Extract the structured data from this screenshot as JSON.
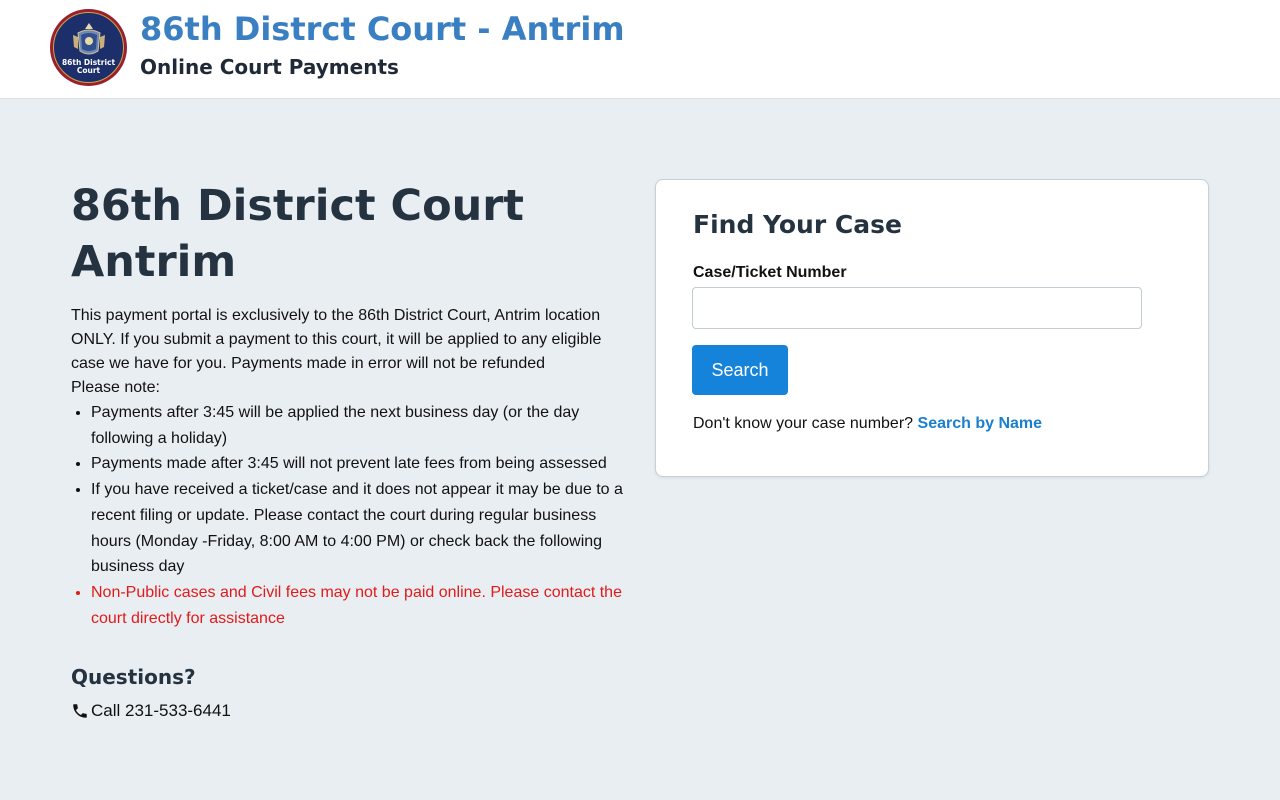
{
  "header": {
    "logo_text_line1": "86th District",
    "logo_text_line2": "Court",
    "title": "86th Distrct Court - Antrim",
    "subtitle": "Online Court Payments"
  },
  "main": {
    "title_line1": "86th District Court",
    "title_line2": "Antrim",
    "intro": "This payment portal is exclusively to the 86th District Court, Antrim location ONLY. If you submit a payment to this court, it will be applied to any eligible case we have for you. Payments made in error will not be refunded",
    "note_label": "Please note:",
    "notes": [
      "Payments after 3:45 will be applied the next business day (or the day following a holiday)",
      "Payments made after 3:45 will not prevent late fees from being assessed",
      "If you have received a ticket/case and it does not appear it may be due to a recent filing or update. Please contact the court during regular business hours (Monday -Friday, 8:00 AM to 4:00 PM) or check back the following business day",
      "Non-Public cases and Civil fees may not be paid online. Please contact the court directly for assistance"
    ],
    "questions_heading": "Questions?",
    "phone": "Call 231-533-6441"
  },
  "find_case": {
    "title": "Find Your Case",
    "field_label": "Case/Ticket Number",
    "input_value": "",
    "search_label": "Search",
    "hint_text": "Don't know your case number?",
    "search_by_name_label": "Search by Name"
  },
  "icons": {
    "phone": "phone-icon",
    "logo": "court-seal-logo"
  },
  "colors": {
    "title_blue": "#3a7fc1",
    "button_blue": "#1583d9",
    "link_blue": "#1a7fcf",
    "warning_red": "#e01b1b",
    "page_background": "#e9eef2"
  }
}
